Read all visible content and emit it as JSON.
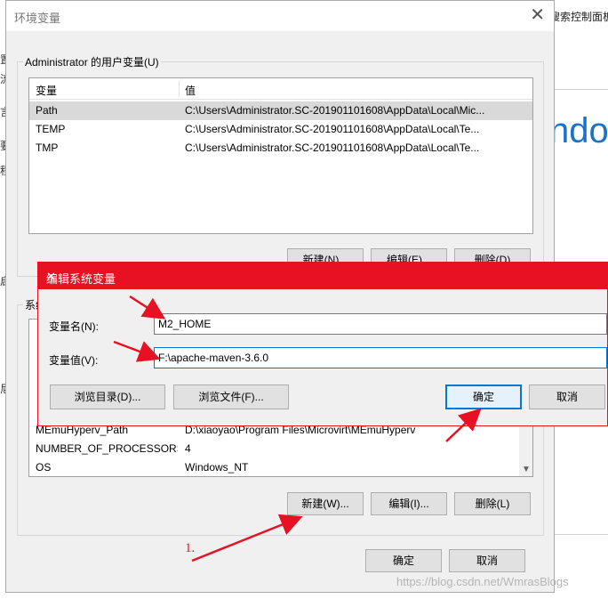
{
  "background": {
    "right_title": "搜索控制面板",
    "big_text": "ndo",
    "left_chars": [
      "置",
      "流",
      "言",
      "要",
      "程",
      "启",
      "尼"
    ]
  },
  "env_dialog": {
    "title": "环境变量",
    "user_group": {
      "legend": "Administrator 的用户变量(U)",
      "col_var": "变量",
      "col_val": "值",
      "rows": [
        {
          "name": "Path",
          "value": "C:\\Users\\Administrator.SC-201901101608\\AppData\\Local\\Mic..."
        },
        {
          "name": "TEMP",
          "value": "C:\\Users\\Administrator.SC-201901101608\\AppData\\Local\\Te..."
        },
        {
          "name": "TMP",
          "value": "C:\\Users\\Administrator.SC-201901101608\\AppData\\Local\\Te..."
        }
      ],
      "new_button": "新建(N)...",
      "edit_button": "编辑(E)...",
      "delete_button": "删除(D)"
    },
    "system_group": {
      "legend": "系统变量(S)",
      "rows": [
        {
          "name": "MEmuHyperv_Path",
          "value": "D:\\xiaoyao\\Program Files\\Microvirt\\MEmuHyperv"
        },
        {
          "name": "NUMBER_OF_PROCESSORS",
          "value": "4"
        },
        {
          "name": "OS",
          "value": "Windows_NT"
        }
      ],
      "new_button": "新建(W)...",
      "edit_button": "编辑(I)...",
      "delete_button": "删除(L)"
    },
    "ok_button": "确定",
    "cancel_button": "取消"
  },
  "edit_dialog": {
    "title": "编辑系统变量",
    "name_label": "变量名(N):",
    "name_value": "M2_HOME",
    "value_label": "变量值(V):",
    "value_value": "F:\\apache-maven-3.6.0",
    "browse_dir_button": "浏览目录(D)...",
    "browse_file_button": "浏览文件(F)...",
    "ok_button": "确定",
    "cancel_button": "取消"
  },
  "annotation": {
    "step_label": "1."
  },
  "watermark": "https://blog.csdn.net/WmrasBlogs",
  "colors": {
    "accent_red": "#e81123",
    "focus_blue": "#0078d7",
    "selection": "#d9d9d9"
  }
}
